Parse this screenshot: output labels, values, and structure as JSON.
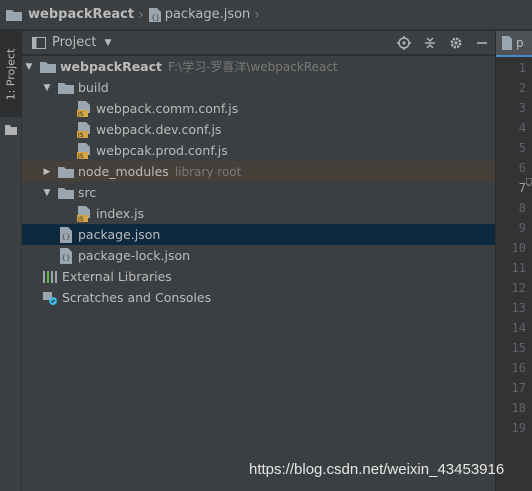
{
  "breadcrumb": {
    "project": "webpackReact",
    "file": "package.json"
  },
  "left_strip": {
    "tab_label": "1: Project"
  },
  "panel": {
    "title": "Project",
    "tools": [
      "locate-icon",
      "collapse-icon",
      "gear-icon",
      "minimize-icon"
    ]
  },
  "tree": {
    "root": {
      "label": "webpackReact",
      "path": "F:\\学习-罗喜洋\\webpackReact"
    },
    "build": "build",
    "build_files": [
      "webpack.comm.conf.js",
      "webpack.dev.conf.js",
      "webpcak.prod.conf.js"
    ],
    "node_modules": {
      "label": "node_modules",
      "hint": "library root"
    },
    "src": "src",
    "src_files": [
      "index.js"
    ],
    "package_json": "package.json",
    "package_lock": "package-lock.json",
    "external_libraries": "External Libraries",
    "scratches": "Scratches and Consoles"
  },
  "editor": {
    "tab_label": "p",
    "line_numbers": [
      "1",
      "2",
      "3",
      "4",
      "5",
      "6",
      "7",
      "8",
      "9",
      "10",
      "11",
      "12",
      "13",
      "14",
      "15",
      "16",
      "17",
      "18",
      "19"
    ],
    "current_line": "7"
  },
  "watermark": "https://blog.csdn.net/weixin_43453916",
  "colors": {
    "background": "#3c3f41",
    "selection": "#0d293e",
    "folder": "#9aa7b0",
    "js_badge": "#d6a643"
  }
}
